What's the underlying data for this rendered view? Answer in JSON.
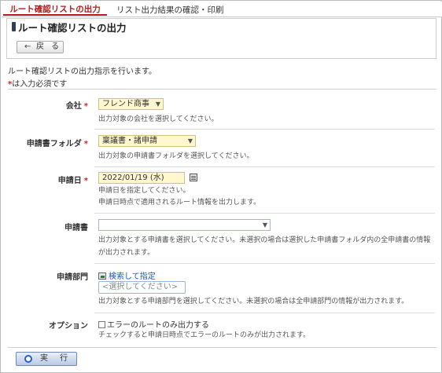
{
  "tabs": {
    "active": "ルート確認リストの出力",
    "next": "リスト出力結果の確認・印刷"
  },
  "header": {
    "title": "ルート確認リストの出力",
    "back_label": "戻 る",
    "back_icon": "arrow-left-icon"
  },
  "instruction": "ルート確認リストの出力指示を行います。",
  "required_note": {
    "mark": "*",
    "text": "は入力必須です"
  },
  "fields": {
    "company": {
      "label": "会社",
      "required_mark": "*",
      "value": "フレンド商事",
      "help": "出力対象の会社を選択してください。"
    },
    "folder": {
      "label": "申請書フォルダ",
      "required_mark": "*",
      "value": "稟議書・諸申請",
      "help": "出力対象の申請書フォルダを選択してください。"
    },
    "date": {
      "label": "申請日",
      "required_mark": "*",
      "value": "2022/01/19 (水)",
      "help1": "申請日を指定してください。",
      "help2": "申請日時点で適用されるルート情報を出力します。"
    },
    "form": {
      "label": "申請書",
      "value": "",
      "help1": "出力対象とする申請書を選択してください。未選択の場合は選択した申請書フォルダ内の全申請書の情報",
      "help2": "が出力されます。"
    },
    "dept": {
      "label": "申請部門",
      "link": "検索して指定",
      "placeholder": "<選択してください>",
      "help": "出力対象とする申請部門を選択してください。未選択の場合は全申請部門の情報が出力されます。"
    },
    "option": {
      "label": "オプション",
      "checkbox_label": "エラーのルートのみ出力する",
      "checked": false,
      "help": "チェックすると申請日時点でエラーのルートのみが出力されます。"
    }
  },
  "footer": {
    "exec_label": "実 行",
    "exec_icon": "circle-icon"
  },
  "colors": {
    "accent_red": "#b31b1b",
    "required_red": "#d42020",
    "required_field_bg": "#fff8cf",
    "link_blue": "#1f56b5"
  }
}
